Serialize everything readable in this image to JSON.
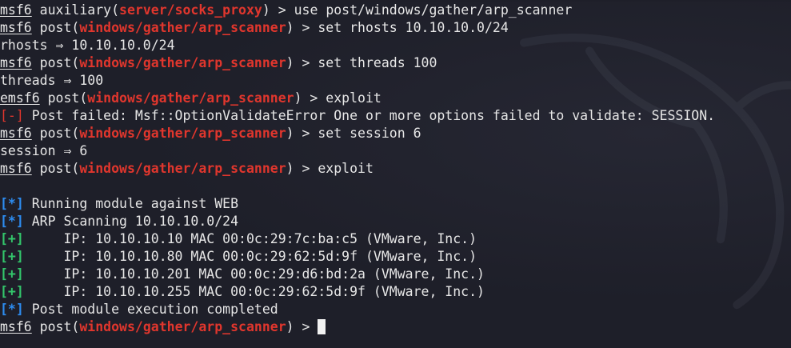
{
  "terminal": {
    "colors": {
      "background": "#1e1f29",
      "text": "#e6e6e6",
      "module": "#e0362d",
      "info": "#2d8cf0",
      "success": "#33c66b"
    },
    "lines": {
      "l1": {
        "prompt": "msf6",
        "cmd_prefix": " auxiliary(",
        "module": "server/socks_proxy",
        "cmd": ") > use post/windows/gather/arp_scanner"
      },
      "l2": {
        "prompt": "msf6",
        "cmd_prefix": " post(",
        "module": "windows/gather/arp_scanner",
        "cmd": ") > set rhosts 10.10.10.0/24"
      },
      "l3": {
        "text": "rhosts ⇒ 10.10.10.0/24"
      },
      "l4": {
        "prompt": "msf6",
        "cmd_prefix": " post(",
        "module": "windows/gather/arp_scanner",
        "cmd": ") > set threads 100"
      },
      "l5": {
        "text": "threads ⇒ 100"
      },
      "l6": {
        "prompt": "emsf6",
        "cmd_prefix": " post(",
        "module": "windows/gather/arp_scanner",
        "cmd": ") > exploit"
      },
      "l7": {
        "marker": "[-]",
        "text": " Post failed: Msf::OptionValidateError One or more options failed to validate: SESSION."
      },
      "l8": {
        "prompt": "msf6",
        "cmd_prefix": " post(",
        "module": "windows/gather/arp_scanner",
        "cmd": ") > set session 6"
      },
      "l9": {
        "text": "session ⇒ 6"
      },
      "l10": {
        "prompt": "msf6",
        "cmd_prefix": " post(",
        "module": "windows/gather/arp_scanner",
        "cmd": ") > exploit"
      },
      "l12": {
        "marker": "[*]",
        "text": " Running module against WEB"
      },
      "l13": {
        "marker": "[*]",
        "text": " ARP Scanning 10.10.10.0/24"
      },
      "l14": {
        "marker": "[+]",
        "text": "     IP: 10.10.10.10 MAC 00:0c:29:7c:ba:c5 (VMware, Inc.)"
      },
      "l15": {
        "marker": "[+]",
        "text": "     IP: 10.10.10.80 MAC 00:0c:29:62:5d:9f (VMware, Inc.)"
      },
      "l16": {
        "marker": "[+]",
        "text": "     IP: 10.10.10.201 MAC 00:0c:29:d6:bd:2a (VMware, Inc.)"
      },
      "l17": {
        "marker": "[+]",
        "text": "     IP: 10.10.10.255 MAC 00:0c:29:62:5d:9f (VMware, Inc.)"
      },
      "l18": {
        "marker": "[*]",
        "text": " Post module execution completed"
      },
      "l19": {
        "prompt": "msf6",
        "cmd_prefix": " post(",
        "module": "windows/gather/arp_scanner",
        "cmd": ") > "
      }
    }
  },
  "icons": {
    "background_logo": "kali-dragon-icon",
    "cursor": "block-cursor-icon"
  }
}
